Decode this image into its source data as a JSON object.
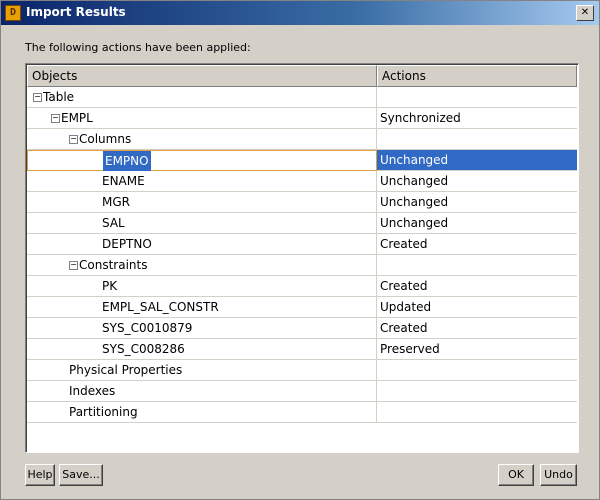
{
  "window": {
    "title": "Import Results",
    "close_symbol": "✕"
  },
  "prompt": "The following actions have been applied:",
  "columns": {
    "objects": "Objects",
    "actions": "Actions"
  },
  "rows": [
    {
      "label": "Table",
      "action": "",
      "level": 0,
      "expander": "−"
    },
    {
      "label": "EMPL",
      "action": "Synchronized",
      "level": 1,
      "expander": "−"
    },
    {
      "label": "Columns",
      "action": "",
      "level": 2,
      "expander": "−"
    },
    {
      "label": "EMPNO",
      "action": "Unchanged",
      "level": 3,
      "expander": "",
      "selected": true
    },
    {
      "label": "ENAME",
      "action": "Unchanged",
      "level": 3,
      "expander": ""
    },
    {
      "label": "MGR",
      "action": "Unchanged",
      "level": 3,
      "expander": ""
    },
    {
      "label": "SAL",
      "action": "Unchanged",
      "level": 3,
      "expander": ""
    },
    {
      "label": "DEPTNO",
      "action": "Created",
      "level": 3,
      "expander": ""
    },
    {
      "label": "Constraints",
      "action": "",
      "level": 2,
      "expander": "−"
    },
    {
      "label": "PK",
      "action": "Created",
      "level": 3,
      "expander": ""
    },
    {
      "label": "EMPL_SAL_CONSTR",
      "action": "Updated",
      "level": 3,
      "expander": ""
    },
    {
      "label": "SYS_C0010879",
      "action": "Created",
      "level": 3,
      "expander": ""
    },
    {
      "label": "SYS_C008286",
      "action": "Preserved",
      "level": 3,
      "expander": ""
    },
    {
      "label": "Physical Properties",
      "action": "",
      "level": 2,
      "expander": ""
    },
    {
      "label": "Indexes",
      "action": "",
      "level": 2,
      "expander": ""
    },
    {
      "label": "Partitioning",
      "action": "",
      "level": 2,
      "expander": ""
    }
  ],
  "buttons": {
    "help": "Help",
    "save": "Save...",
    "ok": "OK",
    "undo": "Undo"
  },
  "icons": {
    "app": "app-icon",
    "close": "close-icon",
    "expand": "collapse-toggle-icon"
  },
  "colors": {
    "selection": "#316ac5",
    "title_bar": "#0a246a",
    "dialog_bg": "#d4d0c8"
  }
}
